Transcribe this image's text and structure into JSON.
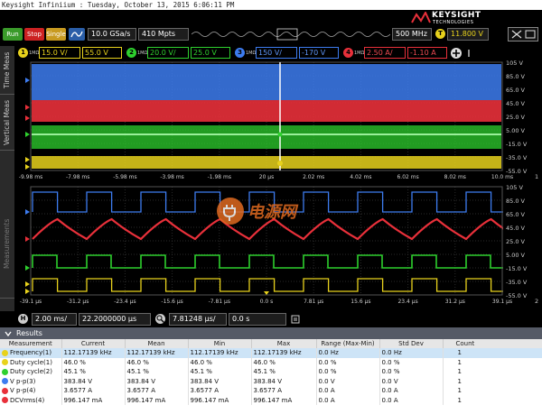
{
  "window": {
    "title": "Keysight Infiniium : Tuesday, October 13, 2015 6:06:11 PM"
  },
  "brand": {
    "name": "KEYSIGHT",
    "sub": "TECHNOLOGIES"
  },
  "toolbar": {
    "run_label": "Run",
    "stop_label": "Stop",
    "single_label": "Single",
    "sample_rate": "10.0 GSa/s",
    "memory_depth": "410 Mpts",
    "bandwidth": "500 MHz",
    "trigger_label": "T",
    "trigger_level": "11.800 V",
    "run_color": "#3a9a2a",
    "stop_color": "#cc2222",
    "single_color": "#c89a20"
  },
  "channels": [
    {
      "num": "1",
      "imp": "1MΩ",
      "scale": "15.0 V/",
      "offset": "55.0 V",
      "color": "#e8d21c"
    },
    {
      "num": "2",
      "imp": "1MΩ",
      "scale": "20.0 V/",
      "offset": "25.0 V",
      "color": "#2ed02e"
    },
    {
      "num": "3",
      "imp": "1MΩ",
      "scale": "150 V/",
      "offset": "-170 V",
      "color": "#3d7cf0"
    },
    {
      "num": "4",
      "imp": "1MΩ",
      "scale": "2.50 A/",
      "offset": "-1.10 A",
      "color": "#e8303a"
    }
  ],
  "sidetabs": {
    "time_meas": "Time Meas",
    "vertical_meas": "Vertical Meas",
    "measurements": "Measurements"
  },
  "upper_plot": {
    "y_labels": [
      "105 V",
      "85.0 V",
      "65.0 V",
      "45.0 V",
      "25.0 V",
      "5.00 V",
      "-15.0 V",
      "-35.0 V",
      "-55.0 V"
    ],
    "x_labels": [
      "-9.98 ms",
      "-7.98 ms",
      "-5.98 ms",
      "-3.98 ms",
      "-1.98 ms",
      "20 µs",
      "2.02 ms",
      "4.02 ms",
      "6.02 ms",
      "8.02 ms",
      "10.0 ms"
    ],
    "right_num": "1"
  },
  "lower_plot": {
    "y_labels": [
      "105 V",
      "85.0 V",
      "65.0 V",
      "45.0 V",
      "25.0 V",
      "5.00 V",
      "-15.0 V",
      "-35.0 V",
      "-55.0 V"
    ],
    "x_labels": [
      "-39.1 µs",
      "-31.2 µs",
      "-23.4 µs",
      "-15.6 µs",
      "-7.81 µs",
      "0.0 s",
      "7.81 µs",
      "15.6 µs",
      "23.4 µs",
      "31.2 µs",
      "39.1 µs"
    ],
    "right_num": "2"
  },
  "watermark": {
    "text": "电源网"
  },
  "horizontal": {
    "h_label": "H",
    "timebase": "2.00 ms/",
    "position": "22.2000000 µs",
    "zoom_label": "Z",
    "zoom_scale": "7.81248 µs/",
    "zoom_position": "0.0 s"
  },
  "results": {
    "title": "Results",
    "columns": [
      "Measurement",
      "Current",
      "Mean",
      "Min",
      "Max",
      "Range (Max-Min)",
      "Std Dev",
      "Count"
    ],
    "rows": [
      {
        "ch_color": "#e8d21c",
        "name": "Frequency(1)",
        "current": "112.17139 kHz",
        "mean": "112.17139 kHz",
        "min": "112.17139 kHz",
        "max": "112.17139 kHz",
        "range": "0.0 Hz",
        "std": "0.0 Hz",
        "count": "1"
      },
      {
        "ch_color": "#e8d21c",
        "name": "Duty cycle(1)",
        "current": "46.0 %",
        "mean": "46.0 %",
        "min": "46.0 %",
        "max": "46.0 %",
        "range": "0.0 %",
        "std": "0.0 %",
        "count": "1"
      },
      {
        "ch_color": "#2ed02e",
        "name": "Duty cycle(2)",
        "current": "45.1 %",
        "mean": "45.1 %",
        "min": "45.1 %",
        "max": "45.1 %",
        "range": "0.0 %",
        "std": "0.0 %",
        "count": "1"
      },
      {
        "ch_color": "#3d7cf0",
        "name": "V p-p(3)",
        "current": "383.84 V",
        "mean": "383.84 V",
        "min": "383.84 V",
        "max": "383.84 V",
        "range": "0.0 V",
        "std": "0.0 V",
        "count": "1"
      },
      {
        "ch_color": "#e8303a",
        "name": "V p-p(4)",
        "current": "3.6577 A",
        "mean": "3.6577 A",
        "min": "3.6577 A",
        "max": "3.6577 A",
        "range": "0.0 A",
        "std": "0.0 A",
        "count": "1"
      },
      {
        "ch_color": "#e8303a",
        "name": "DCVrms(4)",
        "current": "996.147 mA",
        "mean": "996.147 mA",
        "min": "996.147 mA",
        "max": "996.147 mA",
        "range": "0.0 A",
        "std": "0.0 A",
        "count": "1"
      }
    ]
  }
}
